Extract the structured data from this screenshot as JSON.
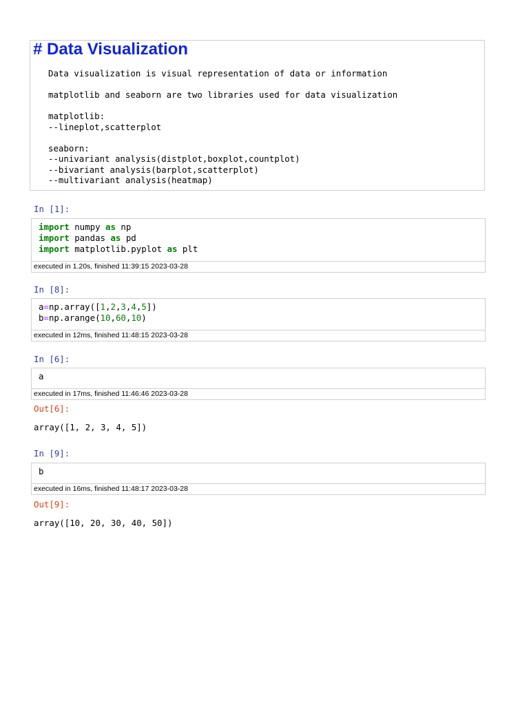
{
  "markdown": {
    "heading": "# Data Visualization",
    "lines": [
      "Data visualization is visual representation of data or information",
      "",
      "matplotlib and seaborn are two libraries used for data visualization",
      "",
      "matplotlib:",
      "--lineplot,scatterplot",
      "",
      "seaborn:",
      "--univariant analysis(distplot,boxplot,countplot)",
      "--bivariant analysis(barplot,scatterplot)",
      "--multivariant analysis(heatmap)"
    ]
  },
  "cells": [
    {
      "prompt": "In [1]:",
      "code": {
        "l1_kw": "import",
        "l1_rest": " numpy ",
        "l1_as": "as",
        "l1_alias": " np",
        "l2_kw": "import",
        "l2_rest": " pandas ",
        "l2_as": "as",
        "l2_alias": " pd",
        "l3_kw": "import",
        "l3_rest": " matplotlib.pyplot ",
        "l3_as": "as",
        "l3_alias": " plt"
      },
      "exec": "executed in 1.20s, finished 11:39:15 2023-03-28"
    },
    {
      "prompt": "In [8]:",
      "code": {
        "l1_var": "a",
        "l1_eq": "=",
        "l1_call": "np.array([",
        "n1": "1",
        "c1": ",",
        "n2": "2",
        "c2": ",",
        "n3": "3",
        "c3": ",",
        "n4": "4",
        "c4": ",",
        "n5": "5",
        "l1_end": "])",
        "l2_var": "b",
        "l2_eq": "=",
        "l2_call": "np.arange(",
        "m1": "10",
        "d1": ",",
        "m2": "60",
        "d2": ",",
        "m3": "10",
        "l2_end": ")"
      },
      "exec": "executed in 12ms, finished 11:48:15 2023-03-28"
    },
    {
      "prompt": "In [6]:",
      "code": {
        "line": "a"
      },
      "exec": "executed in 17ms, finished 11:46:46 2023-03-28",
      "out_prompt": "Out[6]:",
      "output": "array([1, 2, 3, 4, 5])"
    },
    {
      "prompt": "In [9]:",
      "code": {
        "line": "b"
      },
      "exec": "executed in 16ms, finished 11:48:17 2023-03-28",
      "out_prompt": "Out[9]:",
      "output": "array([10, 20, 30, 40, 50])"
    }
  ]
}
